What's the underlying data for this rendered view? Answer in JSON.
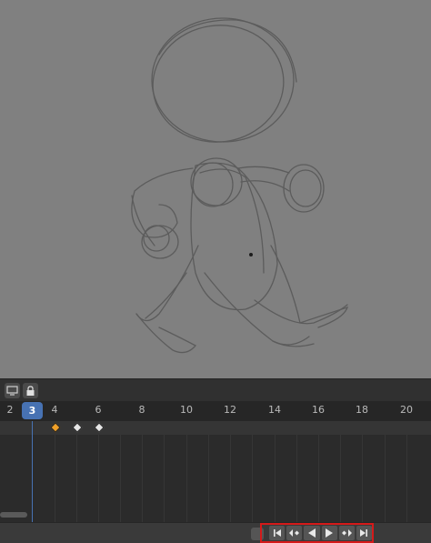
{
  "viewport": {
    "background": "#808080",
    "sketch_color": "#5a5a5a"
  },
  "timeline": {
    "header_buttons": [
      {
        "name": "display-icon"
      },
      {
        "name": "lock-icon"
      }
    ],
    "ruler": {
      "current_frame": "3",
      "ticks": [
        "2",
        "4",
        "6",
        "8",
        "10",
        "12",
        "14",
        "16",
        "18",
        "20"
      ]
    },
    "keyframes": [
      {
        "frame": 4,
        "selected": true,
        "color": "#f0a028"
      },
      {
        "frame": 5,
        "selected": false,
        "color": "#e6e6e6"
      },
      {
        "frame": 6,
        "selected": false,
        "color": "#e6e6e6"
      }
    ],
    "playback": {
      "buttons": [
        "jump-to-start-icon",
        "jump-to-prev-keyframe-icon",
        "play-reverse-icon",
        "play-icon",
        "jump-to-next-keyframe-icon",
        "jump-to-end-icon"
      ],
      "highlight_color": "#d51a1a"
    }
  }
}
